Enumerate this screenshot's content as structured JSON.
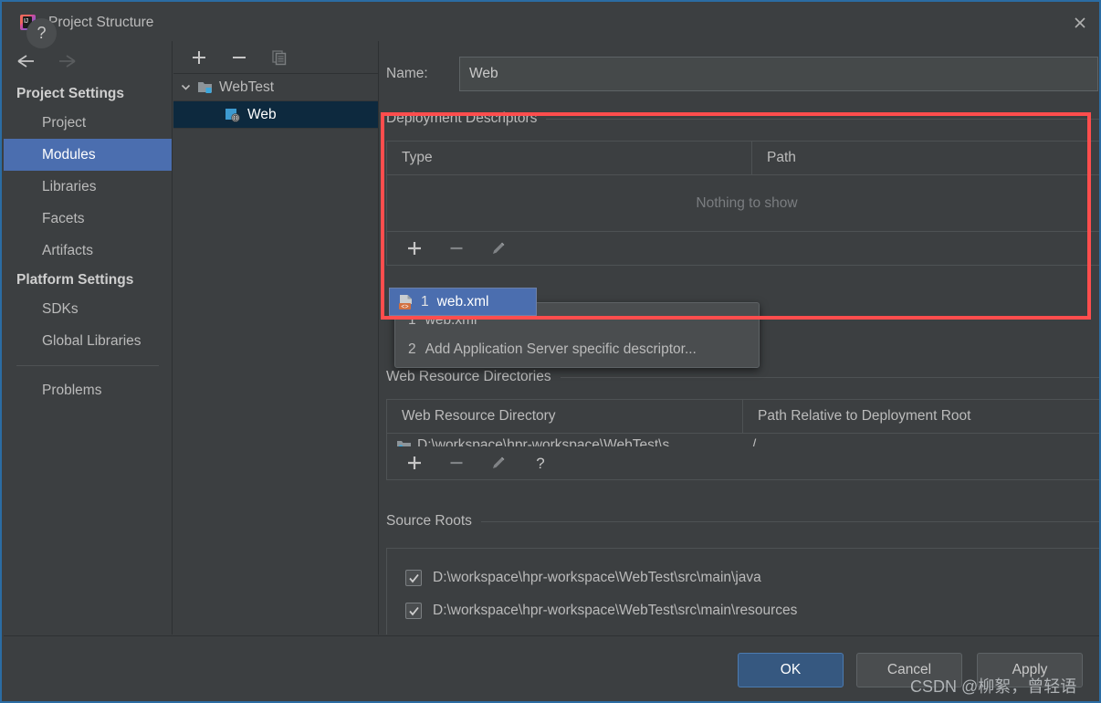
{
  "window": {
    "title": "Project Structure",
    "app_icon": "intellij-idea-icon",
    "close_icon": "close-icon"
  },
  "sidebar": {
    "back_icon": "arrow-left-icon",
    "forward_icon": "arrow-right-icon",
    "groups": [
      {
        "header": "Project Settings",
        "items": [
          {
            "label": "Project",
            "selected": false
          },
          {
            "label": "Modules",
            "selected": true
          },
          {
            "label": "Libraries",
            "selected": false
          },
          {
            "label": "Facets",
            "selected": false
          },
          {
            "label": "Artifacts",
            "selected": false
          }
        ]
      },
      {
        "header": "Platform Settings",
        "items": [
          {
            "label": "SDKs",
            "selected": false
          },
          {
            "label": "Global Libraries",
            "selected": false
          }
        ]
      }
    ],
    "problems": {
      "label": "Problems",
      "selected": false
    }
  },
  "tree": {
    "toolbar": [
      {
        "name": "add-module-button",
        "icon": "plus-icon",
        "enabled": true
      },
      {
        "name": "remove-module-button",
        "icon": "minus-icon",
        "enabled": true
      },
      {
        "name": "copy-module-button",
        "icon": "copy-icon",
        "enabled": false
      }
    ],
    "nodes": [
      {
        "label": "WebTest",
        "icon": "module-folder-icon",
        "expanded": true,
        "chevron": "chevron-down-icon",
        "selected": false,
        "depth": 0
      },
      {
        "label": "Web",
        "icon": "web-facet-icon",
        "selected": true,
        "depth": 1
      }
    ]
  },
  "content": {
    "name_label": "Name:",
    "name_value": "Web",
    "name_placeholder": "",
    "deployment_descriptors": {
      "title": "Deployment Descriptors",
      "columns": [
        "Type",
        "Path"
      ],
      "empty_text": "Nothing to show",
      "rows": [],
      "toolbar": [
        {
          "name": "add-descriptor-button",
          "icon": "plus-icon",
          "enabled": true
        },
        {
          "name": "remove-descriptor-button",
          "icon": "minus-icon",
          "enabled": false
        },
        {
          "name": "edit-descriptor-button",
          "icon": "pencil-icon",
          "enabled": false
        }
      ]
    },
    "web_resource_directories": {
      "title": "Web Resource Directories",
      "columns": [
        "Web Resource Directory",
        "Path Relative to Deployment Root"
      ],
      "rows": [
        {
          "directory": "D:\\workspace\\hpr-workspace\\WebTest\\s",
          "path": "/"
        }
      ],
      "toolbar": [
        {
          "name": "add-web-resource-button",
          "icon": "plus-icon",
          "enabled": true
        },
        {
          "name": "remove-web-resource-button",
          "icon": "minus-icon",
          "enabled": false
        },
        {
          "name": "edit-web-resource-button",
          "icon": "pencil-icon",
          "enabled": false
        },
        {
          "name": "web-resource-help-button",
          "icon": "question-icon",
          "enabled": true
        }
      ]
    },
    "source_roots": {
      "title": "Source Roots",
      "items": [
        {
          "label": "D:\\workspace\\hpr-workspace\\WebTest\\src\\main\\java",
          "checked": true
        },
        {
          "label": "D:\\workspace\\hpr-workspace\\WebTest\\src\\main\\resources",
          "checked": true
        }
      ]
    }
  },
  "popup": {
    "items": [
      {
        "mnemonic": "1",
        "label": "web.xml",
        "icon": "xml-descriptor-icon",
        "selected": true
      },
      {
        "mnemonic": "2",
        "label": "Add Application Server specific descriptor...",
        "icon": "",
        "selected": false
      }
    ]
  },
  "bottom": {
    "help_label": "?",
    "ok_label": "OK",
    "cancel_label": "Cancel",
    "apply_label": "Apply"
  },
  "watermark": "CSDN @柳絮，曾轻语",
  "colors": {
    "accent": "#4b6eaf",
    "ok_button": "#365880",
    "annotation": "#ff4d4d",
    "background": "#3c3f41",
    "tree_selected": "#0d293e"
  }
}
